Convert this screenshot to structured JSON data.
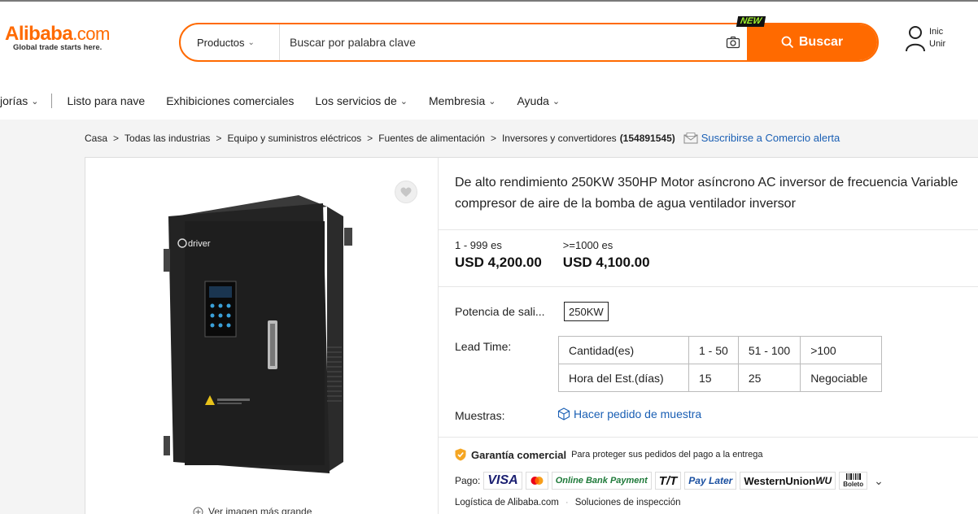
{
  "header": {
    "logo_brand": "Alibaba",
    "logo_suffix": ".com",
    "logo_tagline": "Global trade starts here.",
    "search_category": "Productos",
    "search_placeholder": "Buscar por palabra clave",
    "new_badge": "NEW",
    "search_button": "Buscar",
    "user_line1": "Inic",
    "user_line2": "Unir"
  },
  "nav": {
    "items": [
      "jorías",
      "Listo para nave",
      "Exhibiciones comerciales",
      "Los servicios de",
      "Membresia",
      "Ayuda"
    ]
  },
  "breadcrumb": {
    "items": [
      "Casa",
      "Todas las industrias",
      "Equipo y suministros eléctricos",
      "Fuentes de alimentación",
      "Inversores y convertidores"
    ],
    "count": "(154891545)",
    "subscribe": "Suscribirse a Comercio alerta"
  },
  "product": {
    "image_logo_text": "driver",
    "view_larger": "Ver imagen más grande",
    "title": "De alto rendimiento 250KW 350HP Motor asíncrono AC inversor de frecuencia Variable compresor de aire de la bomba de agua ventilador inversor",
    "prices": [
      {
        "qty": "1 - 999 es",
        "value": "USD 4,200.00"
      },
      {
        "qty": ">=1000 es",
        "value": "USD 4,100.00"
      }
    ],
    "power_label": "Potencia de sali...",
    "power_value": "250KW",
    "lead_time_label": "Lead Time:",
    "lead_table": {
      "row1": [
        "Cantidad(es)",
        "1 - 50",
        "51 - 100",
        ">100"
      ],
      "row2": [
        "Hora del Est.(días)",
        "15",
        "25",
        "Negociable"
      ]
    },
    "samples_label": "Muestras:",
    "samples_link": "Hacer pedido de muestra",
    "guarantee_title": "Garantía comercial",
    "guarantee_desc": "Para proteger sus pedidos del pago a la entrega",
    "payment_label": "Pago:",
    "payment_methods": [
      "VISA",
      "Online Bank Payment",
      "T/T",
      "Pay Later",
      "WesternUnion",
      "WU",
      "Boleto"
    ],
    "logistics": [
      "Logística de Alibaba.com",
      "Soluciones de inspección"
    ]
  },
  "colors": {
    "accent": "#ff6a00",
    "link": "#1a5fb4",
    "new_badge_text": "#9ff12e"
  }
}
